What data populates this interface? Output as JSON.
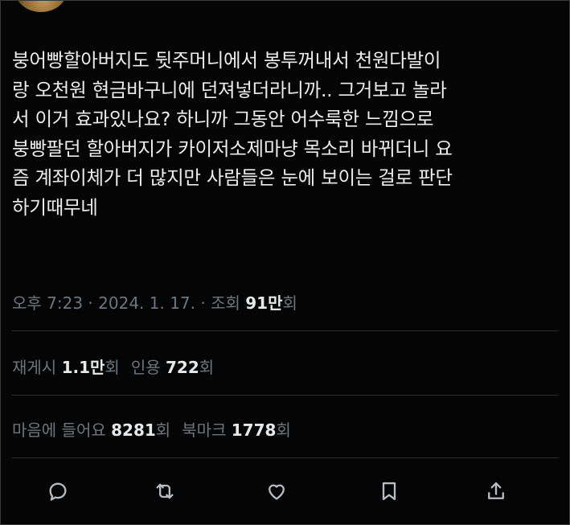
{
  "tweet": {
    "text_lines": [
      "붕어빵할아버지도 뒷주머니에서 봉투꺼내서 천원다발이",
      "랑 오천원 현금바구니에 던져넣더라니까.. 그거보고 놀라",
      "서 이거 효과있나요? 하니까 그동안 어수룩한 느낌으로",
      "붕빵팔던 할아버지가 카이저소제마냥 목소리 바뀌더니 요",
      "즘 계좌이체가 더 많지만 사람들은 눈에 보이는 걸로 판단",
      "하기때무네"
    ]
  },
  "meta": {
    "time": "오후 7:23",
    "sep1": " · ",
    "date": "2024. 1. 17.",
    "sep2": " · ",
    "views_label": "조회 ",
    "views_value": "91만",
    "views_suffix": "회"
  },
  "stats": {
    "reposts_label": "재게시 ",
    "reposts_value": "1.1만",
    "reposts_suffix": "회",
    "quotes_label": "인용 ",
    "quotes_value": "722",
    "quotes_suffix": "회",
    "likes_label": "마음에 들어요 ",
    "likes_value": "8281",
    "likes_suffix": "회",
    "bookmarks_label": "북마크 ",
    "bookmarks_value": "1778",
    "bookmarks_suffix": "회"
  },
  "actions": [
    "reply-icon",
    "repost-icon",
    "like-icon",
    "bookmark-icon",
    "share-icon"
  ]
}
